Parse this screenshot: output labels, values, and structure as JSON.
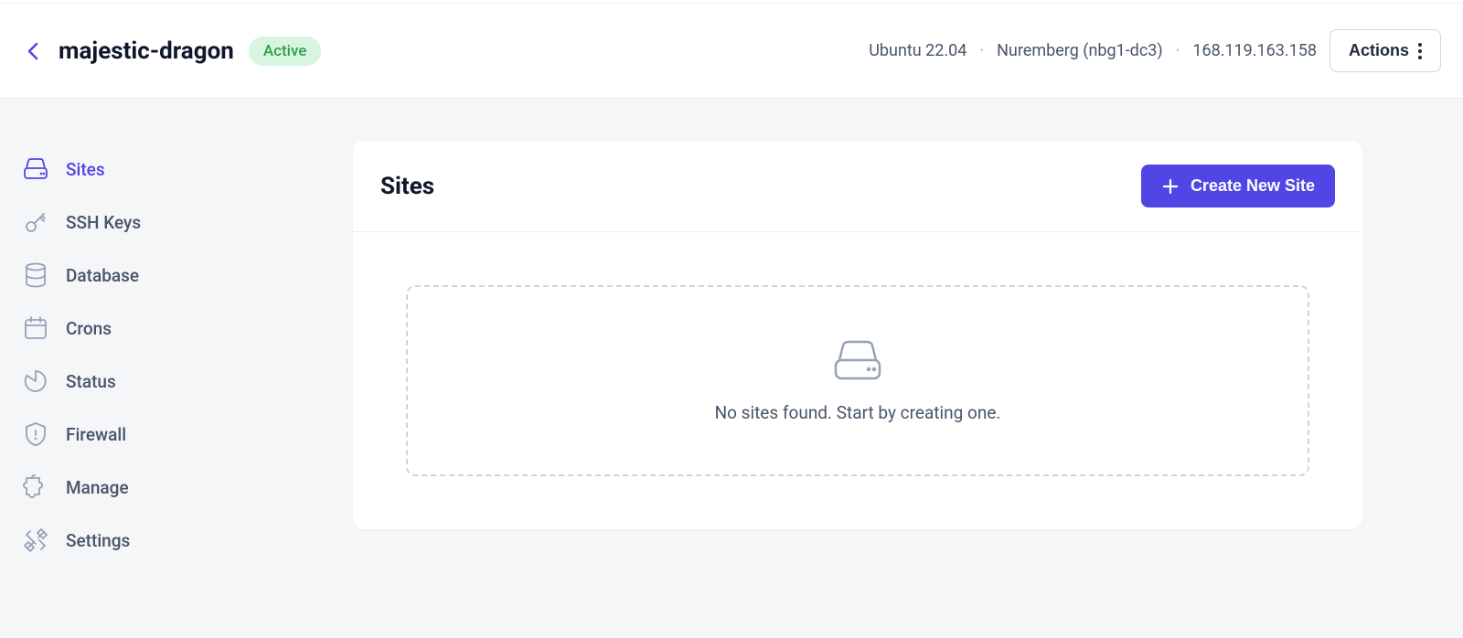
{
  "header": {
    "server_name": "majestic-dragon",
    "status": "Active",
    "os": "Ubuntu 22.04",
    "location": "Nuremberg (nbg1-dc3)",
    "ip": "168.119.163.158",
    "actions_label": "Actions"
  },
  "sidebar": {
    "items": [
      {
        "label": "Sites",
        "icon": "server-icon"
      },
      {
        "label": "SSH Keys",
        "icon": "key-icon"
      },
      {
        "label": "Database",
        "icon": "database-icon"
      },
      {
        "label": "Crons",
        "icon": "calendar-icon"
      },
      {
        "label": "Status",
        "icon": "chart-icon"
      },
      {
        "label": "Firewall",
        "icon": "shield-icon"
      },
      {
        "label": "Manage",
        "icon": "puzzle-icon"
      },
      {
        "label": "Settings",
        "icon": "wrench-icon"
      }
    ]
  },
  "main": {
    "title": "Sites",
    "create_button": "Create New Site",
    "empty_message": "No sites found. Start by creating one."
  },
  "colors": {
    "accent": "#4f46e5",
    "badge_bg": "#d7f5df",
    "badge_text": "#2f9e4f"
  }
}
